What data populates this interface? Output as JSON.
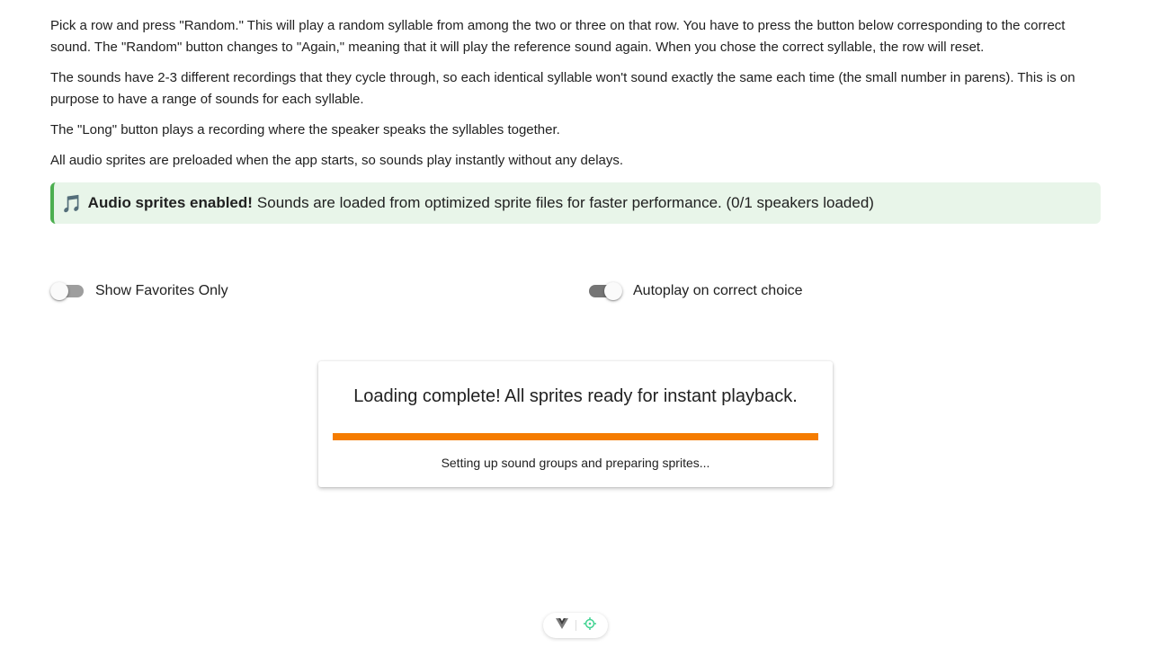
{
  "instructions": {
    "paragraphs": [
      "Pick a row and press \"Random.\" This will play a random syllable from among the two or three on that row. You have to press the button below corresponding to the correct sound. The \"Random\" button changes to \"Again,\" meaning that it will play the reference sound again. When you chose the correct syllable, the row will reset.",
      "The sounds have 2-3 different recordings that they cycle through, so each identical syllable won't sound exactly the same each time (the small number in parens). This is on purpose to have a range of sounds for each syllable.",
      "The \"Long\" button plays a recording where the speaker speaks the syllables together.",
      "All audio sprites are preloaded when the app starts, so sounds play instantly without any delays."
    ]
  },
  "sprite_banner": {
    "icon": "musical-note-icon",
    "icon_glyph": "🎵",
    "bold_text": "Audio sprites enabled!",
    "text": "Sounds are loaded from optimized sprite files for faster performance. (0/1 speakers loaded)"
  },
  "toggles": {
    "favorites": {
      "label": "Show Favorites Only",
      "checked": false
    },
    "autoplay": {
      "label": "Autoplay on correct choice",
      "checked": true
    }
  },
  "loading": {
    "title": "Loading complete! All sprites ready for instant playback.",
    "progress_percent": 100,
    "status": "Setting up sound groups and preparing sprites..."
  },
  "devtools": {
    "icons": [
      "vue-logo-icon",
      "target-icon"
    ]
  },
  "colors": {
    "banner_accent": "#4caf50",
    "banner_background": "#e8f5e9",
    "progress_fill": "#f57c00",
    "switch_track": "#9e9e9e",
    "devtools_target": "#42d392"
  }
}
